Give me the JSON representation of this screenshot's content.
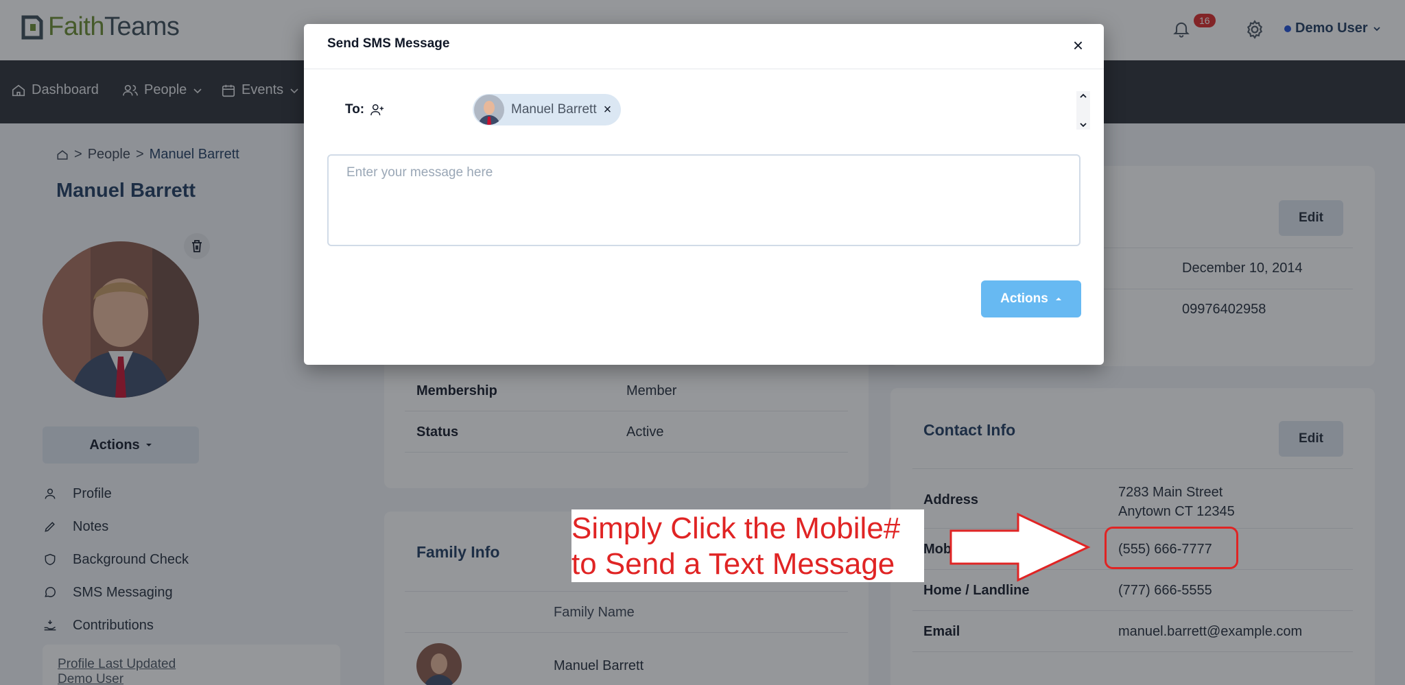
{
  "header": {
    "logo_faith": "Faith",
    "logo_teams": "Teams",
    "notification_count": "16",
    "user_name": "Demo User"
  },
  "nav": {
    "items": [
      {
        "label": "Dashboard",
        "icon": "home-icon"
      },
      {
        "label": "People",
        "icon": "people-icon"
      },
      {
        "label": "Events",
        "icon": "calendar-icon"
      }
    ]
  },
  "breadcrumb": {
    "root_icon": "home-icon",
    "sep1": ">",
    "people": "People",
    "sep2": ">",
    "current": "Manuel Barrett"
  },
  "person": {
    "name": "Manuel Barrett"
  },
  "left_panel": {
    "actions_label": "Actions",
    "menu": [
      {
        "label": "Profile",
        "icon": "user-icon"
      },
      {
        "label": "Notes",
        "icon": "pencil-icon"
      },
      {
        "label": "Background Check",
        "icon": "shield-icon"
      },
      {
        "label": "SMS Messaging",
        "icon": "chat-icon"
      },
      {
        "label": "Contributions",
        "icon": "hand-coin-icon"
      }
    ],
    "profile_updated_label": "Profile Last Updated",
    "profile_updated_by": "Demo User"
  },
  "general_card": {
    "rows": [
      {
        "label": "Membership",
        "value": "Member"
      },
      {
        "label": "Status",
        "value": "Active"
      }
    ]
  },
  "family_card": {
    "title": "Family Info",
    "column": "Family Name",
    "member_name": "Manuel Barrett"
  },
  "right_top_card": {
    "edit_label": "Edit",
    "values": [
      "December 10, 2014",
      "09976402958"
    ]
  },
  "contact_card": {
    "title": "Contact Info",
    "edit_label": "Edit",
    "address_label": "Address",
    "address_line1": "7283 Main Street",
    "address_line2": "Anytown CT 12345",
    "mobile_label": "Mob",
    "mobile_value": "(555) 666-7777",
    "home_label": "Home / Landline",
    "home_value": "(777) 666-5555",
    "email_label": "Email",
    "email_value": "manuel.barrett@example.com"
  },
  "modal": {
    "title": "Send SMS Message",
    "close_label": "×",
    "to_label": "To:",
    "recipient_name": "Manuel Barrett",
    "recipient_remove": "×",
    "message_placeholder": "Enter your message here",
    "actions_label": "Actions"
  },
  "annotation": {
    "line1": "Simply Click the Mobile#",
    "line2": "to Send a Text Message"
  },
  "colors": {
    "nav_bg": "#2b2f35",
    "brand_green": "#6a8c2f",
    "title_navy": "#1e3a5f",
    "actions_blue": "#67b9f2",
    "annotation_red": "#e02424"
  }
}
